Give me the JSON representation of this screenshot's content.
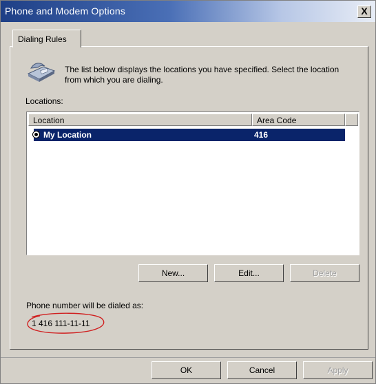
{
  "window": {
    "title": "Phone and Modem Options",
    "close_glyph": "X"
  },
  "tabs": [
    {
      "label": "Dialing Rules"
    }
  ],
  "description": "The list below displays the locations you have specified. Select the location from which you are dialing.",
  "locations_label": "Locations:",
  "table": {
    "headers": [
      "Location",
      "Area Code"
    ],
    "rows": [
      {
        "location": "My Location",
        "area_code": "416",
        "selected": true
      }
    ]
  },
  "buttons": {
    "new": "New...",
    "edit": "Edit...",
    "delete": "Delete"
  },
  "dialed": {
    "label": "Phone number will be dialed as:",
    "value": "1 416 111-11-11"
  },
  "footer": {
    "ok": "OK",
    "cancel": "Cancel",
    "apply": "Apply"
  },
  "icons": {
    "phone": "phone-icon",
    "close": "close-icon",
    "radio": "selected-location-icon"
  },
  "colors": {
    "selection": "#0a246a",
    "annotation": "#d02020",
    "face": "#d4d0c8"
  }
}
